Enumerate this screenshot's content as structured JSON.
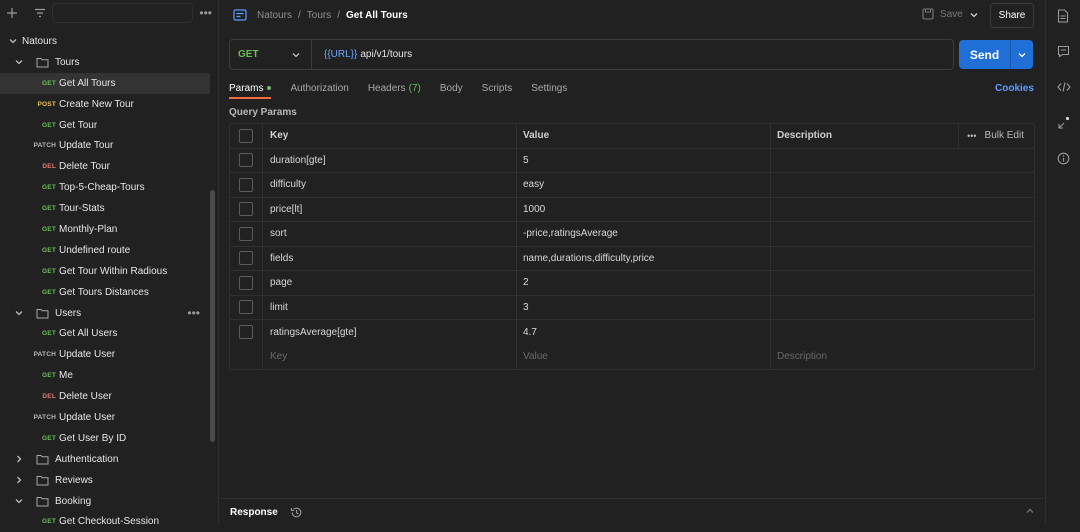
{
  "sidebar": {
    "tree": [
      {
        "type": "collection",
        "label": "Natours",
        "expanded": true
      },
      {
        "type": "folder",
        "label": "Tours",
        "expanded": true
      },
      {
        "type": "request",
        "method": "GET",
        "label": "Get All Tours",
        "selected": true
      },
      {
        "type": "request",
        "method": "POST",
        "label": "Create New Tour"
      },
      {
        "type": "request",
        "method": "GET",
        "label": "Get Tour"
      },
      {
        "type": "request",
        "method": "PATCH",
        "label": "Update Tour"
      },
      {
        "type": "request",
        "method": "DEL",
        "label": "Delete Tour"
      },
      {
        "type": "request",
        "method": "GET",
        "label": "Top-5-Cheap-Tours"
      },
      {
        "type": "request",
        "method": "GET",
        "label": "Tour-Stats"
      },
      {
        "type": "request",
        "method": "GET",
        "label": "Monthly-Plan"
      },
      {
        "type": "request",
        "method": "GET",
        "label": "Undefined route"
      },
      {
        "type": "request",
        "method": "GET",
        "label": "Get Tour Within Radious"
      },
      {
        "type": "request",
        "method": "GET",
        "label": "Get Tours Distances"
      },
      {
        "type": "folder",
        "label": "Users",
        "expanded": true,
        "more": true
      },
      {
        "type": "request",
        "method": "GET",
        "label": "Get All Users"
      },
      {
        "type": "request",
        "method": "PATCH",
        "label": "Update User"
      },
      {
        "type": "request",
        "method": "GET",
        "label": "Me"
      },
      {
        "type": "request",
        "method": "DEL",
        "label": "Delete User"
      },
      {
        "type": "request",
        "method": "PATCH",
        "label": "Update User"
      },
      {
        "type": "request",
        "method": "GET",
        "label": "Get User By ID"
      },
      {
        "type": "folder",
        "label": "Authentication",
        "expanded": false
      },
      {
        "type": "folder",
        "label": "Reviews",
        "expanded": false
      },
      {
        "type": "folder",
        "label": "Booking",
        "expanded": true
      },
      {
        "type": "request",
        "method": "GET",
        "label": "Get Checkout-Session"
      }
    ]
  },
  "header": {
    "breadcrumb": [
      "Natours",
      "Tours"
    ],
    "current": "Get All Tours",
    "save_label": "Save",
    "share_label": "Share"
  },
  "request": {
    "method": "GET",
    "url_var": "{{URL}}",
    "url_path": "api/v1/tours",
    "send_label": "Send"
  },
  "tabs": {
    "params": "Params",
    "authorization": "Authorization",
    "headers": "Headers",
    "headers_count": "(7)",
    "body": "Body",
    "scripts": "Scripts",
    "settings": "Settings",
    "cookies": "Cookies"
  },
  "params": {
    "title": "Query Params",
    "col_key": "Key",
    "col_value": "Value",
    "col_description": "Description",
    "bulk_edit": "Bulk Edit",
    "rows": [
      {
        "key": "duration[gte]",
        "value": "5"
      },
      {
        "key": "difficulty",
        "value": "easy"
      },
      {
        "key": "price[lt]",
        "value": "1000"
      },
      {
        "key": "sort",
        "value": "-price,ratingsAverage"
      },
      {
        "key": "fields",
        "value": "name,durations,difficulty,price"
      },
      {
        "key": "page",
        "value": "2"
      },
      {
        "key": "limit",
        "value": "3"
      },
      {
        "key": "ratingsAverage[gte]",
        "value": "4.7"
      }
    ],
    "placeholder_key": "Key",
    "placeholder_value": "Value",
    "placeholder_description": "Description"
  },
  "response": {
    "label": "Response"
  },
  "colors": {
    "get": "#6bbd5b",
    "post": "#e8c04a",
    "patch": "#b8b8b8",
    "del": "#e07a6b",
    "accent_blue": "#1f6fd6",
    "active_tab": "#f26b3a"
  }
}
